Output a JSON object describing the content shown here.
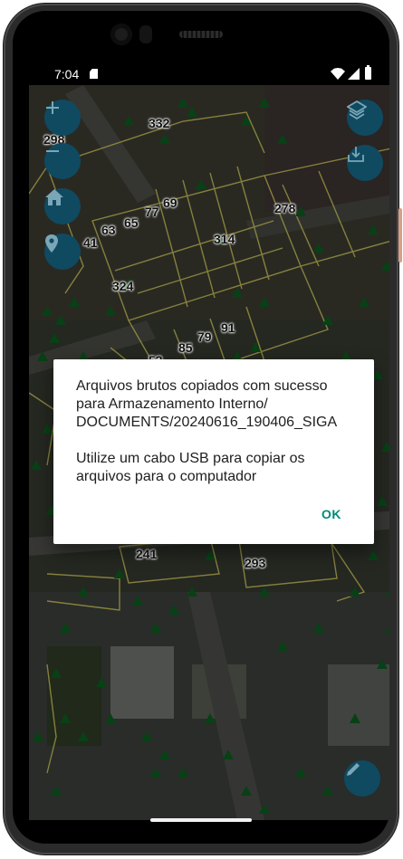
{
  "status_bar": {
    "time": "7:04"
  },
  "map": {
    "parcel_labels": [
      {
        "id": "l332",
        "text": "332"
      },
      {
        "id": "l278",
        "text": "278"
      },
      {
        "id": "l314",
        "text": "314"
      },
      {
        "id": "l324",
        "text": "324"
      },
      {
        "id": "l65",
        "text": "65"
      },
      {
        "id": "l77",
        "text": "77"
      },
      {
        "id": "l69",
        "text": "69"
      },
      {
        "id": "l63",
        "text": "63"
      },
      {
        "id": "l91",
        "text": "91"
      },
      {
        "id": "l79",
        "text": "79"
      },
      {
        "id": "l85",
        "text": "85"
      },
      {
        "id": "l241",
        "text": "241"
      },
      {
        "id": "l293",
        "text": "293"
      },
      {
        "id": "l53",
        "text": "53"
      },
      {
        "id": "l298",
        "text": "298"
      },
      {
        "id": "l41",
        "text": "41"
      }
    ],
    "colors": {
      "parcel_lines": "#c8c05a",
      "trees": "#0b5a1e",
      "fab": "#0f4a61"
    }
  },
  "toolbar": {
    "zoom_in_icon": "plus-icon",
    "zoom_out_icon": "minus-icon",
    "home_icon": "home-icon",
    "location_icon": "location-pin-icon",
    "layers_icon": "layers-icon",
    "download_icon": "download-icon",
    "edit_icon": "pencil-icon"
  },
  "dialog": {
    "message": "Arquivos brutos copiados com sucesso para Armazenamento Interno/ DOCUMENTS/20240616_190406_SIGA\n\nUtilize um cabo USB para copiar os arquivos para o computador",
    "ok_label": "OK",
    "accent_color": "#00897b"
  }
}
